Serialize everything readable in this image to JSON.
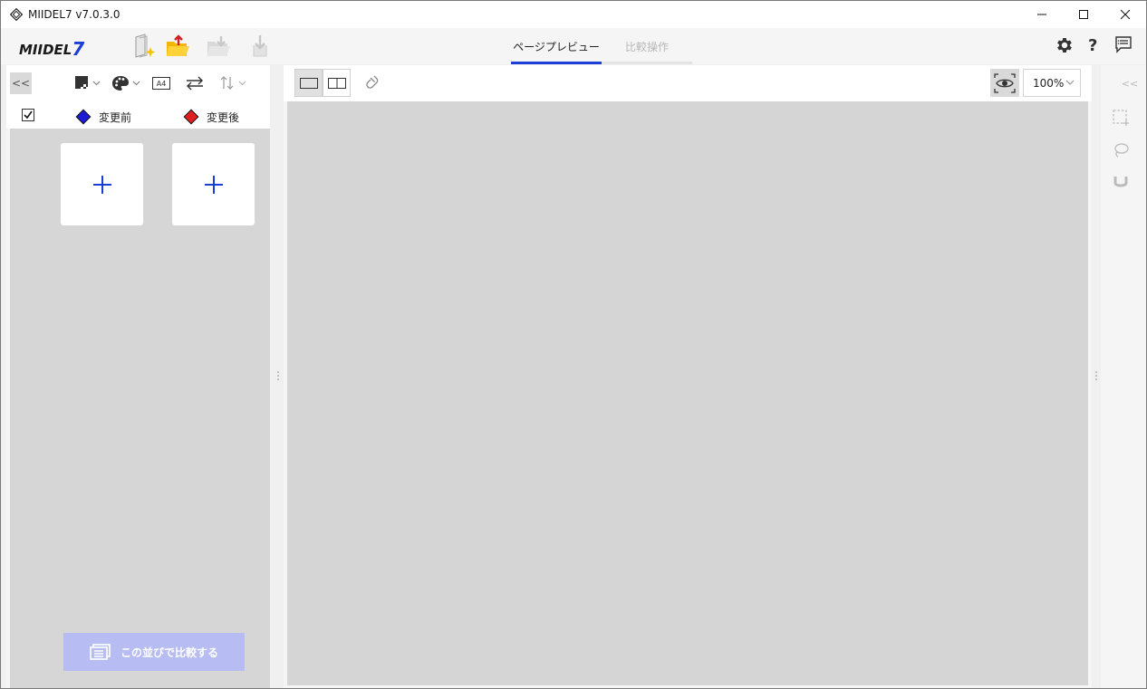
{
  "window": {
    "title": "MIIDEL7  v7.0.3.0"
  },
  "app": {
    "logo_text": "MIIDEL",
    "logo_number": "7"
  },
  "toolbar": {
    "icons": [
      "new-project-icon",
      "open-folder-icon",
      "save-folder-icon",
      "export-icon"
    ]
  },
  "tabs": [
    {
      "label": "ページプレビュー",
      "active": true
    },
    {
      "label": "比較操作",
      "active": false,
      "disabled": true
    }
  ],
  "header_right": {
    "icons": [
      "gear-icon",
      "help-icon",
      "feedback-icon"
    ],
    "help_label": "?"
  },
  "left_panel": {
    "collapse_label": "<<",
    "tools": [
      "mask-icon",
      "palette-icon",
      "paper-size-icon",
      "swap-icon",
      "sort-icon"
    ],
    "paper_size": "A4",
    "legend": {
      "checked": true,
      "before_label": "変更前",
      "after_label": "変更後",
      "before_color": "#1b1bd6",
      "after_color": "#e02020"
    },
    "slots": [
      {
        "label": "+"
      },
      {
        "label": "+"
      }
    ],
    "compare_button": "この並びで比較する"
  },
  "center": {
    "view_modes": [
      "single-page-icon",
      "two-page-icon"
    ],
    "zoom": "100%"
  },
  "right_panel": {
    "collapse_label": "<<",
    "tools": [
      "rect-select-icon",
      "lasso-icon",
      "magnet-icon"
    ]
  }
}
